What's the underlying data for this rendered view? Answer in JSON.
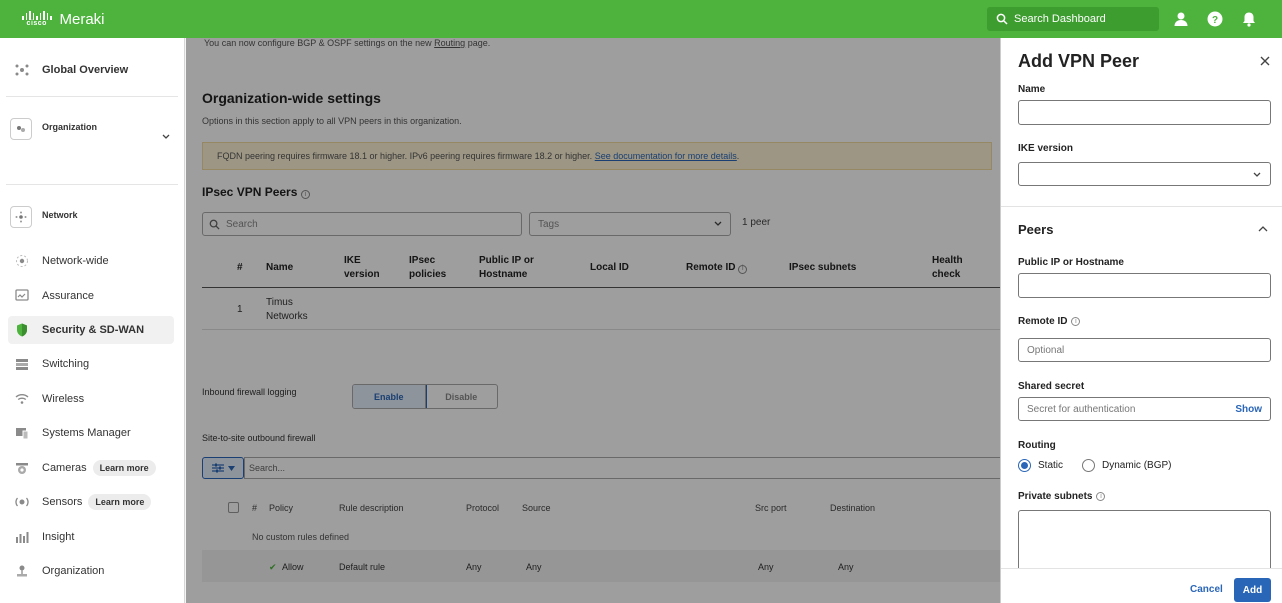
{
  "app": {
    "brand": "Meraki",
    "cisco": "cisco"
  },
  "topbar": {
    "search_placeholder": "Search Dashboard"
  },
  "sidebar": {
    "global_overview": "Global Overview",
    "organization_card": "Organization",
    "network_card": "Network",
    "items": [
      {
        "label": "Network-wide",
        "icon": "network-wide-icon"
      },
      {
        "label": "Assurance",
        "icon": "assurance-icon"
      },
      {
        "label": "Security & SD-WAN",
        "icon": "shield-icon",
        "active": true
      },
      {
        "label": "Switching",
        "icon": "switch-icon"
      },
      {
        "label": "Wireless",
        "icon": "wifi-icon"
      },
      {
        "label": "Systems Manager",
        "icon": "systems-manager-icon"
      },
      {
        "label": "Cameras",
        "icon": "camera-icon",
        "badge": "Learn more"
      },
      {
        "label": "Sensors",
        "icon": "sensor-icon",
        "badge": "Learn more"
      },
      {
        "label": "Insight",
        "icon": "insight-icon"
      },
      {
        "label": "Organization",
        "icon": "organization-icon"
      }
    ]
  },
  "main": {
    "banner_top": "You can now configure BGP & OSPF settings on the new",
    "banner_link": "Routing",
    "banner_end": "page.",
    "org_title": "Organization-wide settings",
    "org_desc": "Options in this section apply to all VPN peers in this organization.",
    "notice_text": "FQDN peering requires firmware 18.1 or higher. IPv6 peering requires firmware 18.2 or higher.",
    "notice_link": "See documentation for more details",
    "ipsec_title": "IPsec VPN Peers",
    "search_placeholder": "Search",
    "tags_placeholder": "Tags",
    "peer_count": "1 peer",
    "columns": {
      "num": "#",
      "name": "Name",
      "ike_1": "IKE",
      "ike_2": "version",
      "ipsec_1": "IPsec",
      "ipsec_2": "policies",
      "pub_1": "Public IP or",
      "pub_2": "Hostname",
      "local_id": "Local ID",
      "remote_id": "Remote ID",
      "ipsec_subnets": "IPsec subnets",
      "health_1": "Health",
      "health_2": "check"
    },
    "row": {
      "num": "1",
      "name_1": "Timus",
      "name_2": "Networks"
    },
    "fw_logging_label": "Inbound firewall logging",
    "enable": "Enable",
    "disable": "Disable",
    "s2s_label": "Site-to-site outbound firewall",
    "fw_search_placeholder": "Search...",
    "fw_columns": {
      "num": "#",
      "policy": "Policy",
      "rule_desc": "Rule description",
      "protocol": "Protocol",
      "source": "Source",
      "src_port": "Src port",
      "destination": "Destination"
    },
    "no_rules": "No custom rules defined",
    "default_row": {
      "policy": "Allow",
      "rule_desc": "Default rule",
      "protocol": "Any",
      "source": "Any",
      "src_port": "Any",
      "destination": "Any"
    }
  },
  "panel": {
    "title": "Add VPN Peer",
    "name_label": "Name",
    "name_value": "",
    "ike_label": "IKE version",
    "ike_value": "",
    "peers_title": "Peers",
    "public_ip_label": "Public IP or Hostname",
    "public_ip_value": "",
    "remote_id_label": "Remote ID",
    "remote_id_placeholder": "Optional",
    "shared_secret_label": "Shared secret",
    "shared_secret_placeholder": "Secret for authentication",
    "show_label": "Show",
    "routing_label": "Routing",
    "routing_static": "Static",
    "routing_dynamic": "Dynamic (BGP)",
    "routing_selected": "Static",
    "private_subnets_label": "Private subnets",
    "cancel": "Cancel",
    "add": "Add"
  },
  "colors": {
    "brand_green": "#4db33d",
    "accent_blue": "#2a66b8"
  }
}
